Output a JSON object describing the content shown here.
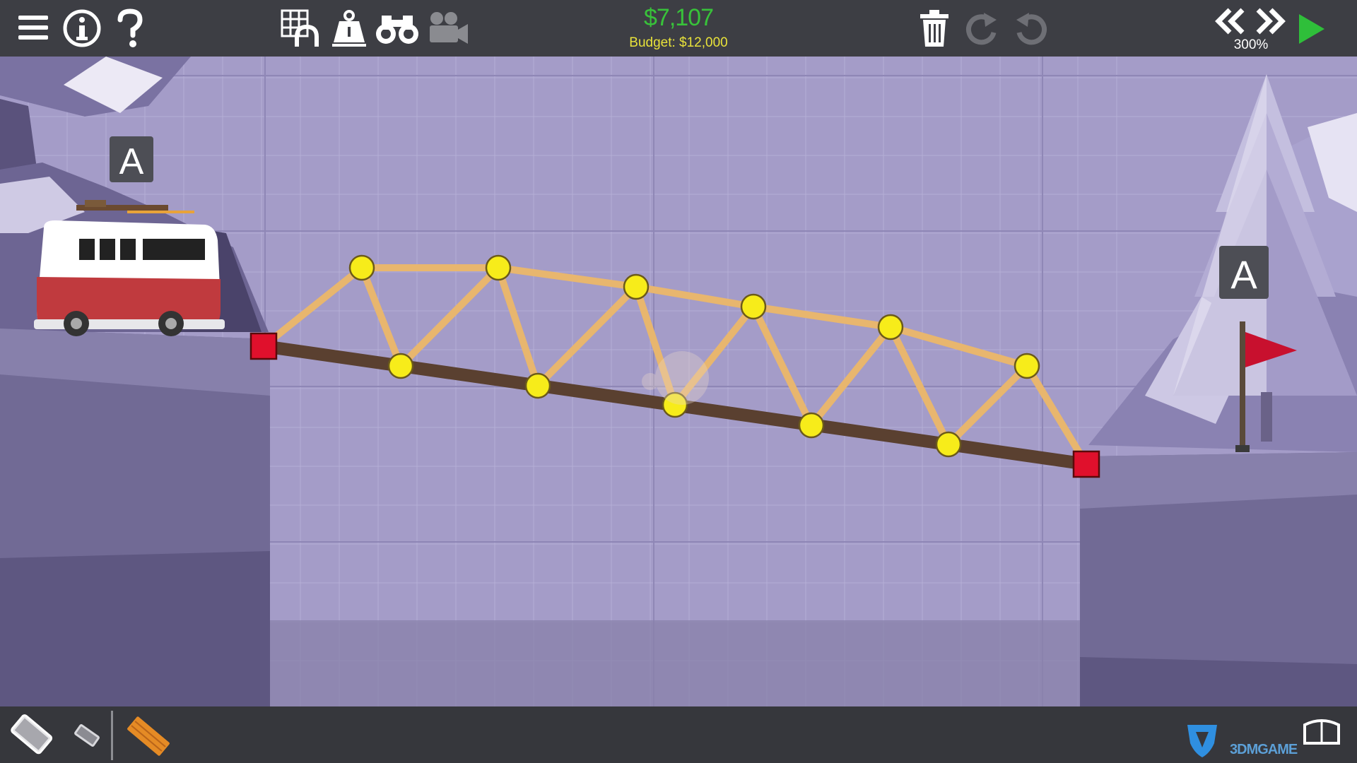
{
  "hud": {
    "cost": "$7,107",
    "budget": "Budget: $12,000",
    "sim_speed": "300%"
  },
  "anchors": {
    "left_marker": "A",
    "right_marker": "A"
  },
  "watermark": "3DMGAME",
  "icons": {
    "menu": "hamburger-menu-icon",
    "info": "info-icon",
    "help": "question-icon",
    "grid": "grid-arch-icon",
    "weight": "weight-icon",
    "binoculars": "binoculars-icon",
    "camera": "camera-icon",
    "trash": "trash-icon",
    "redo": "redo-icon",
    "undo": "undo-icon",
    "rewind": "rewind-icon",
    "fast_forward": "fast-forward-icon",
    "play": "play-icon"
  },
  "colors": {
    "money": "#38c23a",
    "budget": "#e8e23a",
    "road": "#5a4030",
    "wood": "#e8b66e",
    "joint": "#f7ec1a",
    "anchor": "#e0102c",
    "flag": "#c8102e"
  },
  "materials": [
    "road",
    "reinforced road",
    "wood"
  ]
}
